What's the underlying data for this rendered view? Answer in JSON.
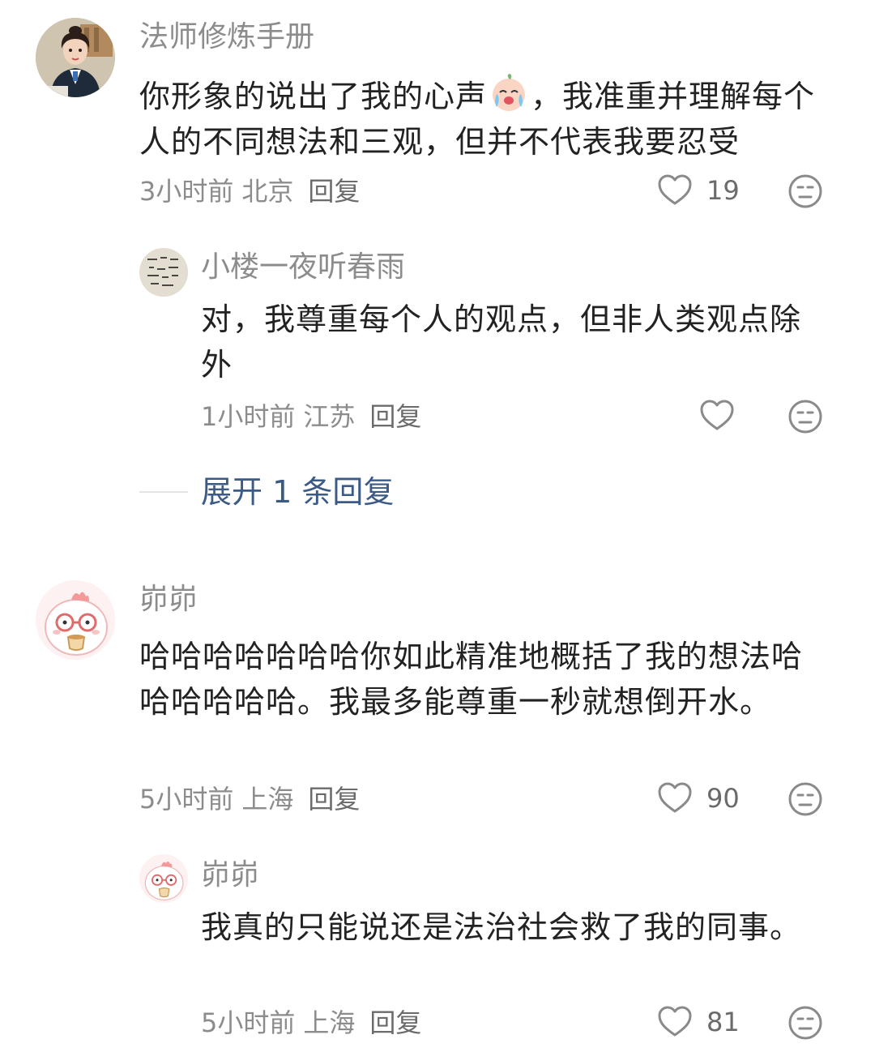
{
  "comments": [
    {
      "username": "法师修炼手册",
      "text_before_emoji": "你形象的说出了我的心声",
      "emoji": "crying-laughing-face",
      "text_after_emoji": "，我准重并理解每个人的不同想法和三观，但并不代表我要忍受",
      "time": "3小时前",
      "location": "北京",
      "reply_label": "回复",
      "likes": "19",
      "avatar_icon": "lawyer-avatar",
      "replies": [
        {
          "username": "小楼一夜听春雨",
          "text": "对，我尊重每个人的观点，但非人类观点除外",
          "time": "1小时前",
          "location": "江苏",
          "reply_label": "回复",
          "likes": "",
          "avatar_icon": "calligraphy-avatar"
        }
      ],
      "expand_label": "展开 1 条回复"
    },
    {
      "username": "峁峁",
      "text": "哈哈哈哈哈哈哈你如此精准地概括了我的想法哈哈哈哈哈哈。我最多能尊重一秒就想倒开水。",
      "time": "5小时前",
      "location": "上海",
      "reply_label": "回复",
      "likes": "90",
      "avatar_icon": "cartoon-chick-avatar",
      "replies": [
        {
          "username": "峁峁",
          "text": "我真的只能说还是法治社会救了我的同事。",
          "time": "5小时前",
          "location": "上海",
          "reply_label": "回复",
          "likes": "81",
          "avatar_icon": "cartoon-chick-avatar"
        }
      ]
    }
  ],
  "colors": {
    "username": "#8c8c8c",
    "content": "#222222",
    "meta": "#8c8c8c",
    "expand": "#3b5a85",
    "icon": "#8a8a8a"
  }
}
